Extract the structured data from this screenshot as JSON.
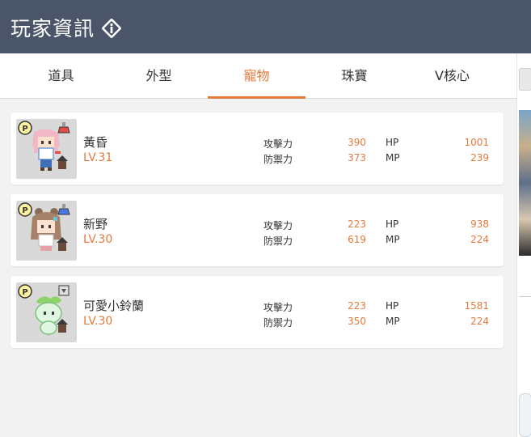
{
  "header": {
    "title": "玩家資訊",
    "info_icon": "info-diamond-icon",
    "bg": "#4b5569"
  },
  "tabs": [
    {
      "label": "道具",
      "active": false
    },
    {
      "label": "外型",
      "active": false
    },
    {
      "label": "寵物",
      "active": true
    },
    {
      "label": "珠寶",
      "active": false
    },
    {
      "label": "V核心",
      "active": false
    }
  ],
  "accent": "#e37a3e",
  "stat_labels": {
    "atk": "攻擊力",
    "def": "防禦力",
    "hp": "HP",
    "mp": "MP"
  },
  "pets": [
    {
      "name": "黃昏",
      "level": "LV.31",
      "atk": "390",
      "def": "373",
      "hp": "1001",
      "mp": "239",
      "badge": "p-coin-icon",
      "item": "potion-red-icon"
    },
    {
      "name": "新野",
      "level": "LV.30",
      "atk": "223",
      "def": "619",
      "hp": "938",
      "mp": "224",
      "badge": "p-coin-icon",
      "item": "potion-blue-icon"
    },
    {
      "name": "可愛小鈴蘭",
      "level": "LV.30",
      "atk": "223",
      "def": "350",
      "hp": "1581",
      "mp": "224",
      "badge": "p-coin-icon",
      "item": "gray-box-icon"
    }
  ]
}
